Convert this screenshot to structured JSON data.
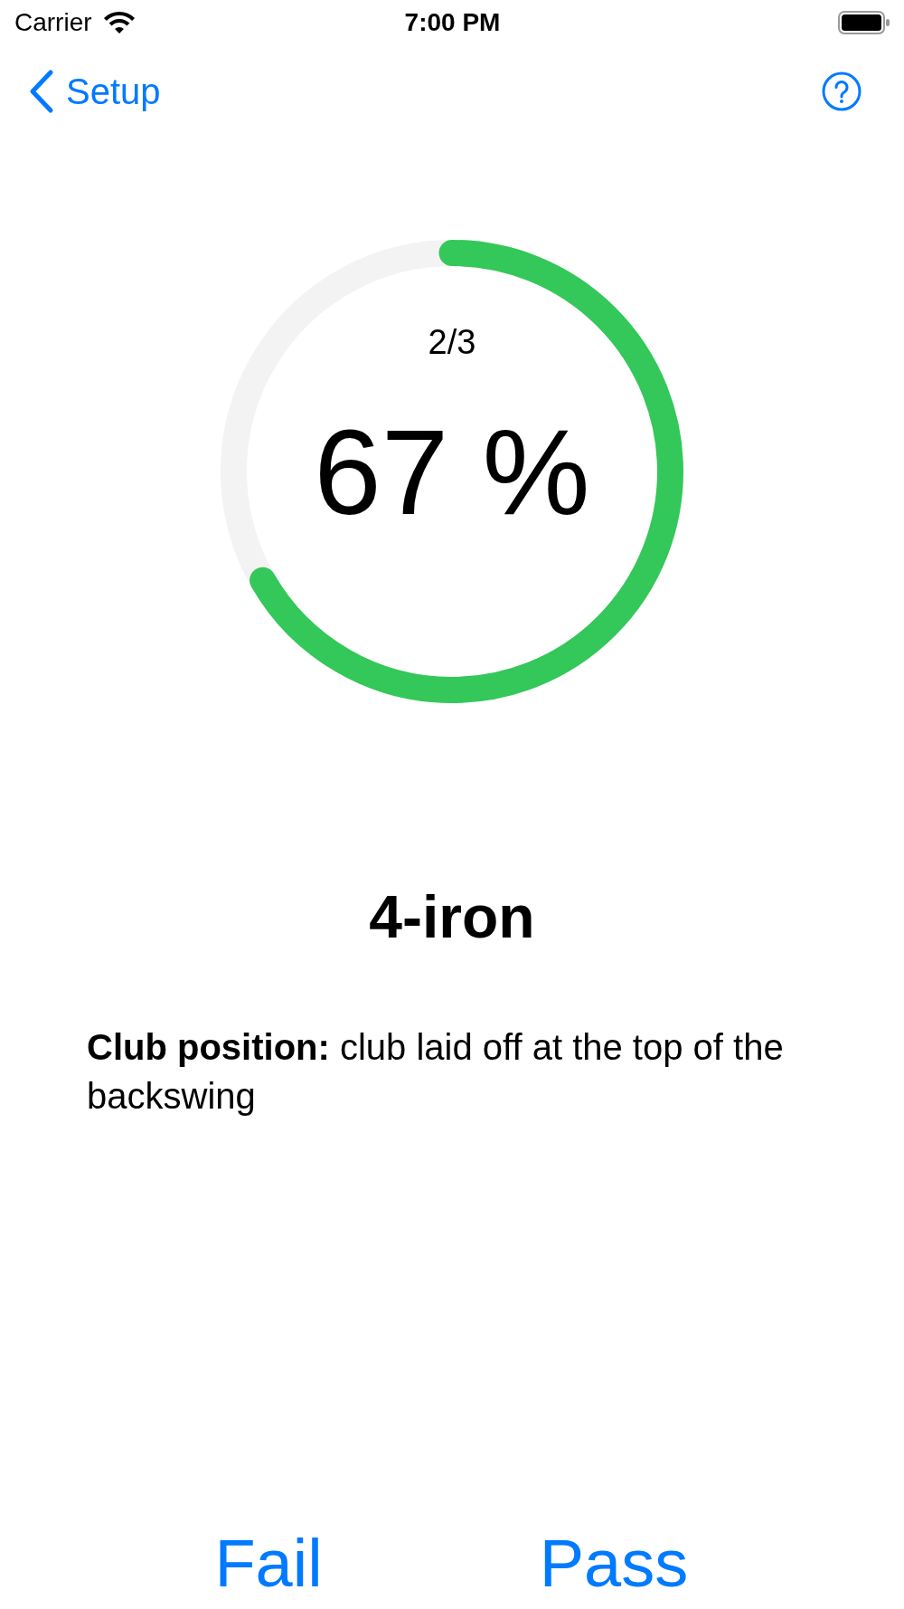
{
  "status_bar": {
    "carrier": "Carrier",
    "time": "7:00 PM"
  },
  "nav_bar": {
    "back_label": "Setup"
  },
  "progress": {
    "count": "2/3",
    "percent": "67 %",
    "level": 0.667
  },
  "club": {
    "title": "4-iron",
    "description": "**Club position:** club laid off at the top of the backswing"
  },
  "buttons": [
    "Fail",
    "Pass"
  ]
}
